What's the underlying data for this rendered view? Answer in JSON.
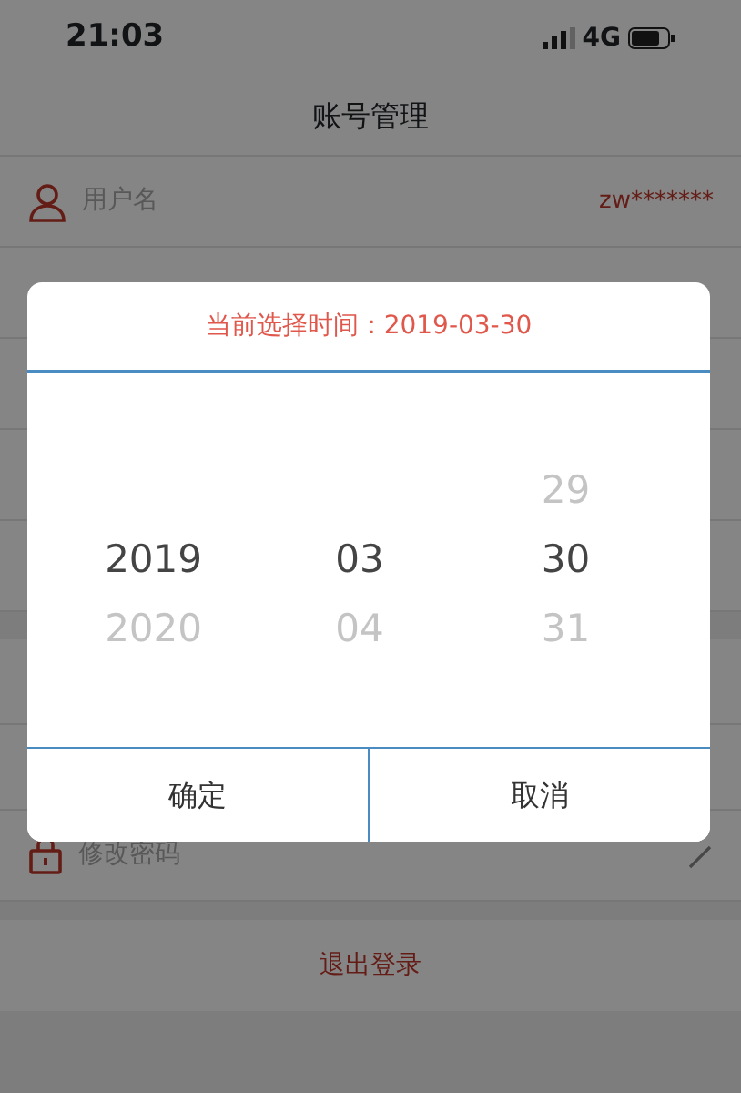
{
  "status_bar": {
    "time": "21:03",
    "network": "4G"
  },
  "header": {
    "title": "账号管理"
  },
  "account_rows": [
    {
      "label": "用户名",
      "value": "zw*******",
      "kind": "user"
    },
    {
      "label": "修改密码",
      "kind": "lock"
    }
  ],
  "logout_button": "退出登录",
  "date_picker": {
    "title": "当前选择时间：2019-03-30",
    "columns": [
      [
        {
          "label": "2019",
          "selected": true
        },
        {
          "label": "2020",
          "selected": false
        }
      ],
      [
        {
          "label": "03",
          "selected": true
        },
        {
          "label": "04",
          "selected": false
        }
      ],
      [
        {
          "label": "29",
          "selected": false
        },
        {
          "label": "30",
          "selected": true
        },
        {
          "label": "31",
          "selected": false
        }
      ]
    ],
    "buttons": [
      "确定",
      "取消"
    ]
  }
}
